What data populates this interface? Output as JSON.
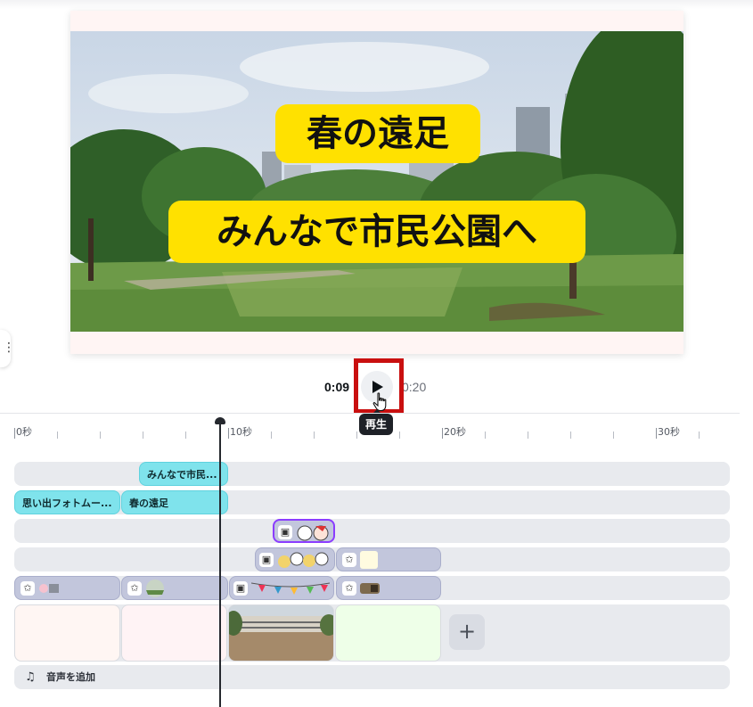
{
  "preview": {
    "caption_title": "春の遠足",
    "caption_subtitle": "みんなで市民公園へ"
  },
  "side_tab_icon": "ellipsis-icon",
  "playback": {
    "current_time": "0:09",
    "total_time": "0:20",
    "play_tooltip": "再生"
  },
  "ruler": {
    "labels": [
      "0秒",
      "10秒",
      "20秒",
      "30秒"
    ]
  },
  "timeline": {
    "text_track_1": {
      "clip_label": "みんなで市民..."
    },
    "text_track_2": {
      "clip_a_label": "思い出フォトムー...",
      "clip_b_label": "春の遠足"
    },
    "add_scene_label": "+",
    "audio_label": "音声を追加"
  },
  "colors": {
    "caption_bg": "#ffe100",
    "text_clip": "#7fe3ec",
    "sticker_clip": "#c2c6dc",
    "selected_border": "#8b3dff",
    "highlight_box": "#c90f0f"
  }
}
